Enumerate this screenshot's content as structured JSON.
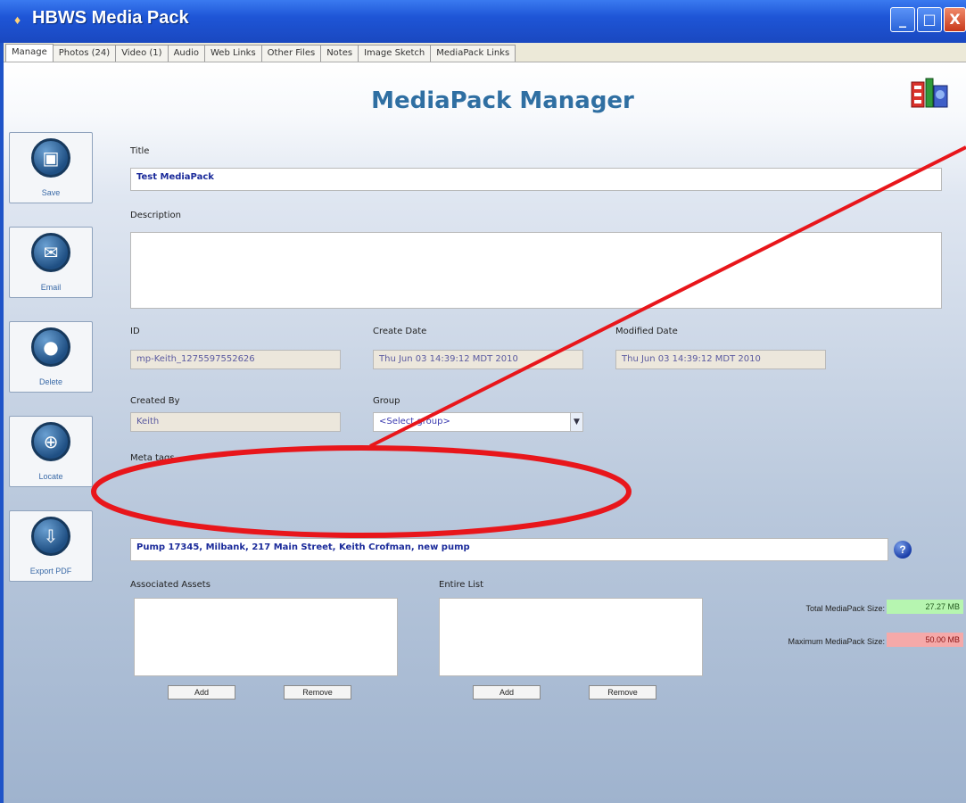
{
  "window": {
    "title": "HBWS Media Pack",
    "controls": {
      "minimize": "_",
      "maximize": "□",
      "close": "X"
    }
  },
  "tabs": [
    "Manage",
    "Photos (24)",
    "Video (1)",
    "Audio",
    "Web Links",
    "Other Files",
    "Notes",
    "Image Sketch",
    "MediaPack Links"
  ],
  "active_tab": "Manage",
  "header": {
    "title": "MediaPack Manager",
    "logo_icon": "mediapack-logo-icon"
  },
  "sidebar": [
    {
      "label": "Save",
      "icon": "save-icon",
      "glyph": "▣"
    },
    {
      "label": "Email",
      "icon": "email-icon",
      "glyph": "✉"
    },
    {
      "label": "Delete",
      "icon": "delete-icon",
      "glyph": "●"
    },
    {
      "label": "Locate",
      "icon": "locate-icon",
      "glyph": "⊕"
    },
    {
      "label": "Export PDF",
      "icon": "export-icon",
      "glyph": "⇩"
    }
  ],
  "form": {
    "title_label": "Title",
    "title_value": "Test MediaPack",
    "description_label": "Description",
    "description_value": "",
    "id_label": "ID",
    "id_value": "mp-Keith_1275597552626",
    "create_date_label": "Create Date",
    "create_date_value": "Thu Jun 03 14:39:12 MDT 2010",
    "modified_date_label": "Modified Date",
    "modified_date_value": "Thu Jun 03 14:39:12 MDT 2010",
    "created_by_label": "Created By",
    "created_by_value": "Keith",
    "group_label": "Group",
    "group_value": "<Select group>",
    "tags_label": "Meta tags",
    "tags_value": "Pump 17345, Milbank, 217 Main Street, Keith Crofman, new pump",
    "associated_assets_label": "Associated Assets",
    "entire_list_label": "Entire List",
    "add_label": "Add",
    "remove_label": "Remove"
  },
  "sizes": {
    "total_label": "Total MediaPack Size:",
    "total_value": "27.27 MB",
    "total_color": "#b6f5b0",
    "max_label": "Maximum MediaPack Size:",
    "max_value": "50.00 MB",
    "max_color": "#f5a9a9"
  },
  "annotation_color": "#e8161b"
}
